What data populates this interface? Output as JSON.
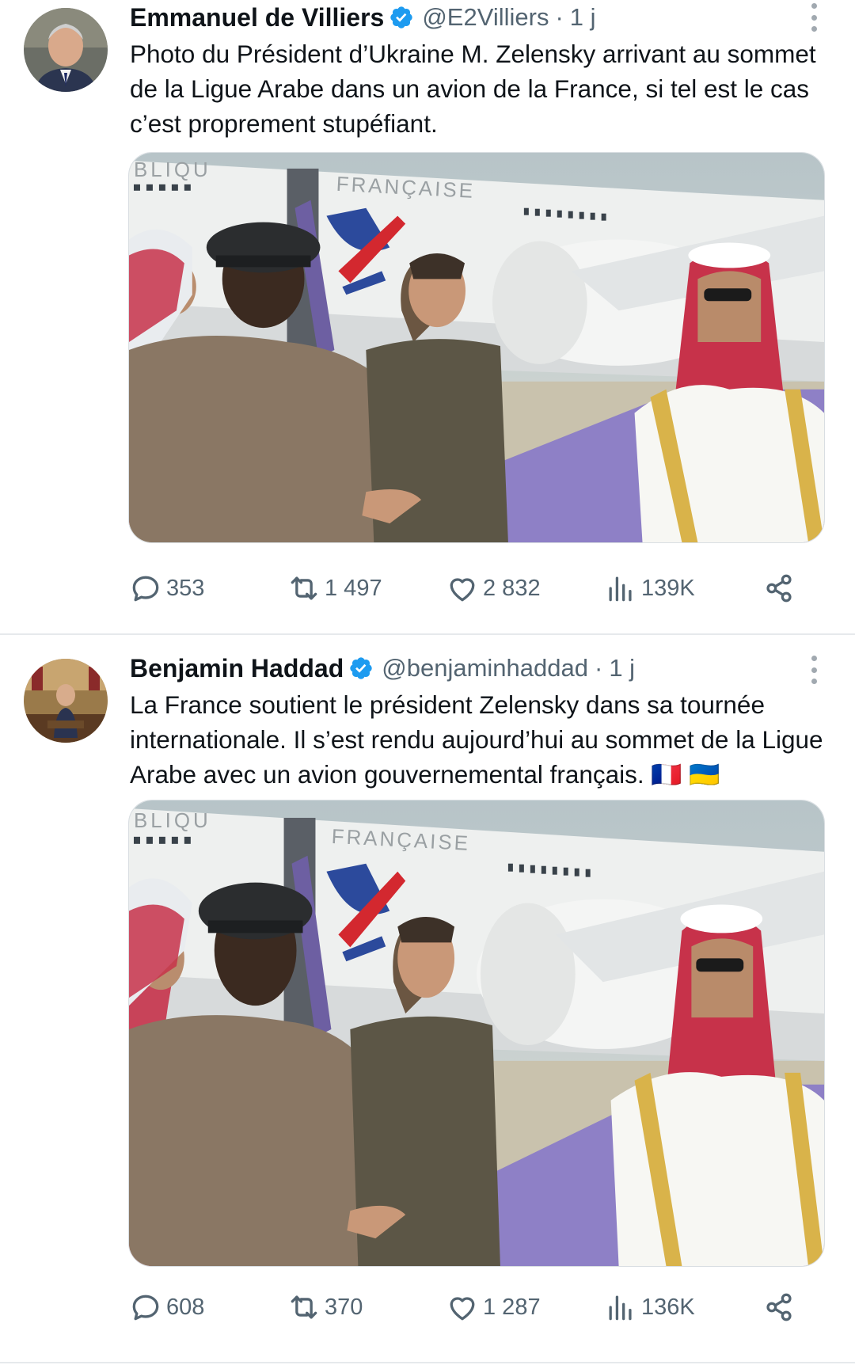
{
  "colors": {
    "accent": "#1d9bf0",
    "muted": "#536471",
    "divider": "#e6e9ec"
  },
  "tweets": [
    {
      "author_name": "Emmanuel de Villiers",
      "handle": "@E2Villiers",
      "separator": "·",
      "time": "1 j",
      "verified_icon": "verified-badge-icon",
      "text": "Photo du Président d’Ukraine M. Zelensky arrivant au sommet de la Ligue Arabe dans un avion de la France, si tel est le cas c’est proprement stupéfiant.",
      "photo_lettering": {
        "left": "BLIQU",
        "fuselage": "FRANÇAISE"
      },
      "stats": {
        "replies": "353",
        "reposts": "1 497",
        "likes": "2 832",
        "views": "139K"
      }
    },
    {
      "author_name": "Benjamin Haddad",
      "handle": "@benjaminhaddad",
      "separator": "·",
      "time": "1 j",
      "verified_icon": "verified-badge-icon",
      "text": "La France soutient le président Zelensky dans sa tournée internationale. Il s’est rendu aujourd’hui au sommet de la Ligue Arabe avec un avion gouvernemental français. 🇫🇷 🇺🇦",
      "photo_lettering": {
        "left": "BLIQU",
        "fuselage": "FRANÇAISE"
      },
      "stats": {
        "replies": "608",
        "reposts": "370",
        "likes": "1 287",
        "views": "136K"
      }
    }
  ],
  "icons": {
    "reply": "speech-bubble-icon",
    "repost": "repost-arrows-icon",
    "like": "heart-icon",
    "views": "bar-chart-icon",
    "share": "share-icon",
    "more": "vertical-dots-icon"
  }
}
